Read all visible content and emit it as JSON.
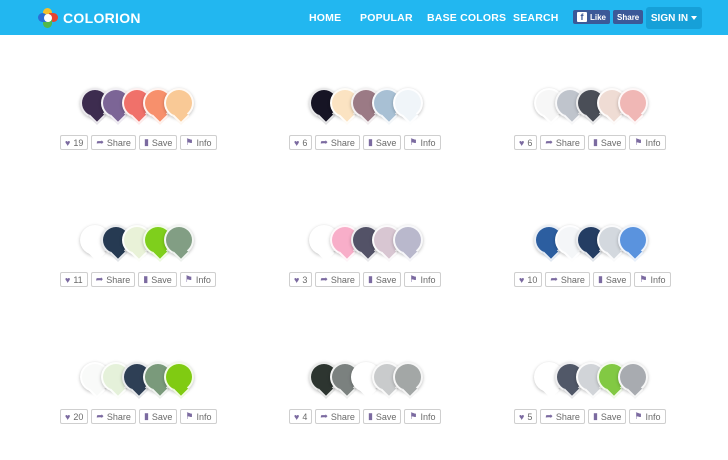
{
  "app": {
    "name": "COLORION"
  },
  "nav": {
    "items": [
      "HOME",
      "POPULAR",
      "BASE COLORS",
      "SEARCH"
    ]
  },
  "facebook": {
    "like_label": "Like",
    "share_label": "Share"
  },
  "auth": {
    "signin_label": "SIGN IN"
  },
  "actions": {
    "share_label": "Share",
    "save_label": "Save",
    "info_label": "Info"
  },
  "palettes": [
    {
      "likes": "19",
      "colors": [
        "#3d2c4f",
        "#7c6596",
        "#f0716a",
        "#f7906c",
        "#f9c996"
      ]
    },
    {
      "likes": "6",
      "colors": [
        "#161424",
        "#fbe3c2",
        "#9b7a85",
        "#a8c0d4",
        "#f0f5f9"
      ]
    },
    {
      "likes": "6",
      "colors": [
        "#f7f7f7",
        "#bfc4cc",
        "#4a4e57",
        "#efdcd4",
        "#f0b7b5"
      ]
    },
    {
      "likes": "11",
      "colors": [
        "#ffffff",
        "#263a52",
        "#e9f2d8",
        "#7fcf1c",
        "#829e84"
      ]
    },
    {
      "likes": "3",
      "colors": [
        "#ffffff",
        "#f8aec9",
        "#535267",
        "#d8c6d2",
        "#b9b8cc"
      ]
    },
    {
      "likes": "10",
      "colors": [
        "#2c5ea0",
        "#f4f6f8",
        "#243d63",
        "#d3d8de",
        "#5a93de"
      ]
    },
    {
      "likes": "20",
      "colors": [
        "#f9faf9",
        "#e5f1da",
        "#2e3f55",
        "#7a9a7b",
        "#80cb12"
      ]
    },
    {
      "likes": "4",
      "colors": [
        "#2d3530",
        "#7b817f",
        "#ffffff",
        "#c9cbcc",
        "#a3a7a6"
      ]
    },
    {
      "likes": "5",
      "colors": [
        "#ffffff",
        "#515868",
        "#d1d4d8",
        "#82c943",
        "#a8abb0"
      ]
    }
  ]
}
